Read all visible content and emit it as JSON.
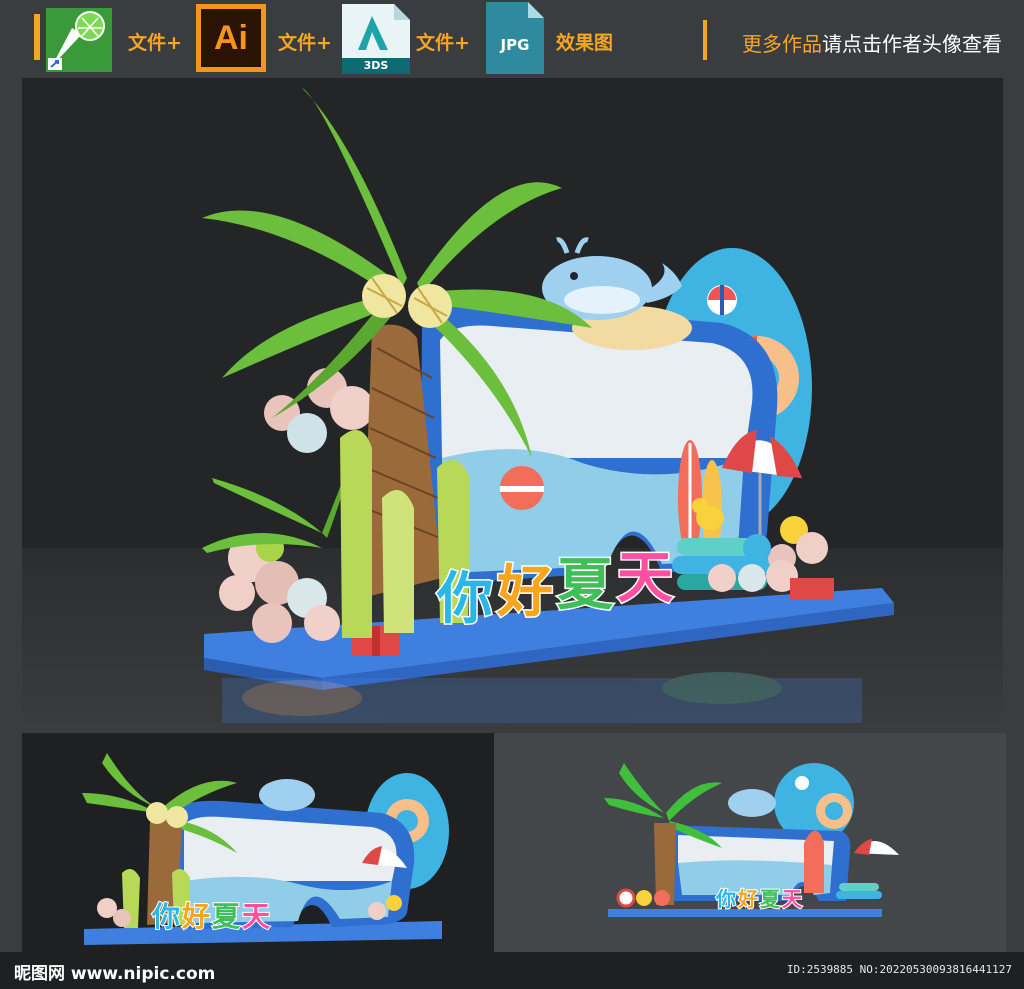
{
  "header": {
    "file_plus_1": "文件+",
    "file_plus_2": "文件+",
    "file_plus_3": "文件+",
    "effect_label": "效果图",
    "ai_badge": "Ai",
    "max_badge": "3DS",
    "jpg_badge": "JPG",
    "more_highlight": "更多作品",
    "more_rest": "请点击作者头像查看"
  },
  "signage": {
    "main_slogan": [
      "你",
      "好",
      "夏",
      "天"
    ],
    "slogan_colors": [
      "#29b6e8",
      "#f7a51c",
      "#3fbf5a",
      "#ff4fa0"
    ]
  },
  "footer": {
    "site": "昵图网 www.nipic.com",
    "id_text": "ID:2539885 NO:20220530093816441127"
  },
  "colors": {
    "accent": "#f5a623",
    "bg": "#3a3d40",
    "scene_dark": "#252729",
    "palm_green": "#6cbf3c",
    "sky_blue": "#4b8fe0"
  }
}
